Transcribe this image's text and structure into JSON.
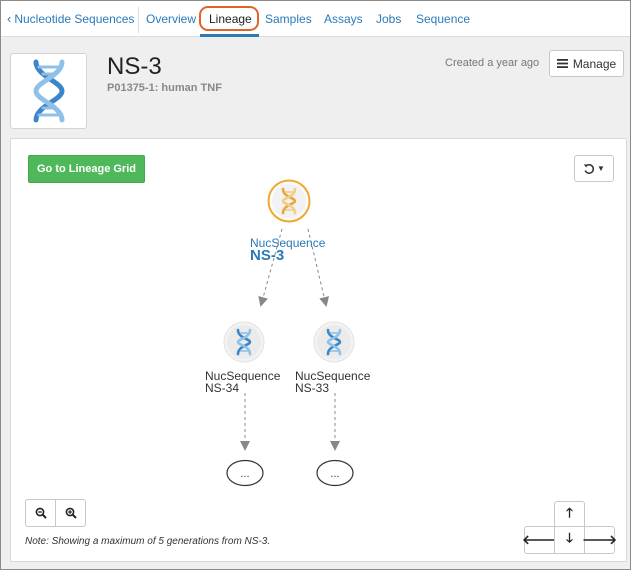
{
  "nav": {
    "back_label": "Nucleotide Sequences",
    "tabs": [
      {
        "label": "Overview"
      },
      {
        "label": "Lineage"
      },
      {
        "label": "Samples"
      },
      {
        "label": "Assays"
      },
      {
        "label": "Jobs"
      },
      {
        "label": "Sequence"
      }
    ],
    "active_tab": "Lineage"
  },
  "header": {
    "title": "NS-3",
    "subtitle": "P01375-1: human TNF",
    "created": "Created a year ago",
    "manage_label": "Manage"
  },
  "lineage": {
    "grid_button": "Go to Lineage Grid",
    "root": {
      "type": "NucSequence",
      "name": "NS-3"
    },
    "children": [
      {
        "type": "NucSequence",
        "name": "NS-34",
        "more": "..."
      },
      {
        "type": "NucSequence",
        "name": "NS-33",
        "more": "..."
      }
    ],
    "note": "Note: Showing a maximum of 5 generations from NS-3."
  },
  "colors": {
    "link": "#2a7ab8",
    "highlight": "#e0642a",
    "grid_button": "#4eb85a",
    "root_ring": "#f0a830",
    "dna_blue": "#3a86c8"
  },
  "icons": {
    "back": "chevron-left-icon",
    "manage": "hamburger-icon",
    "reset": "undo-icon",
    "zoom_out": "zoom-out-icon",
    "zoom_in": "zoom-in-icon",
    "node": "dna-icon"
  }
}
